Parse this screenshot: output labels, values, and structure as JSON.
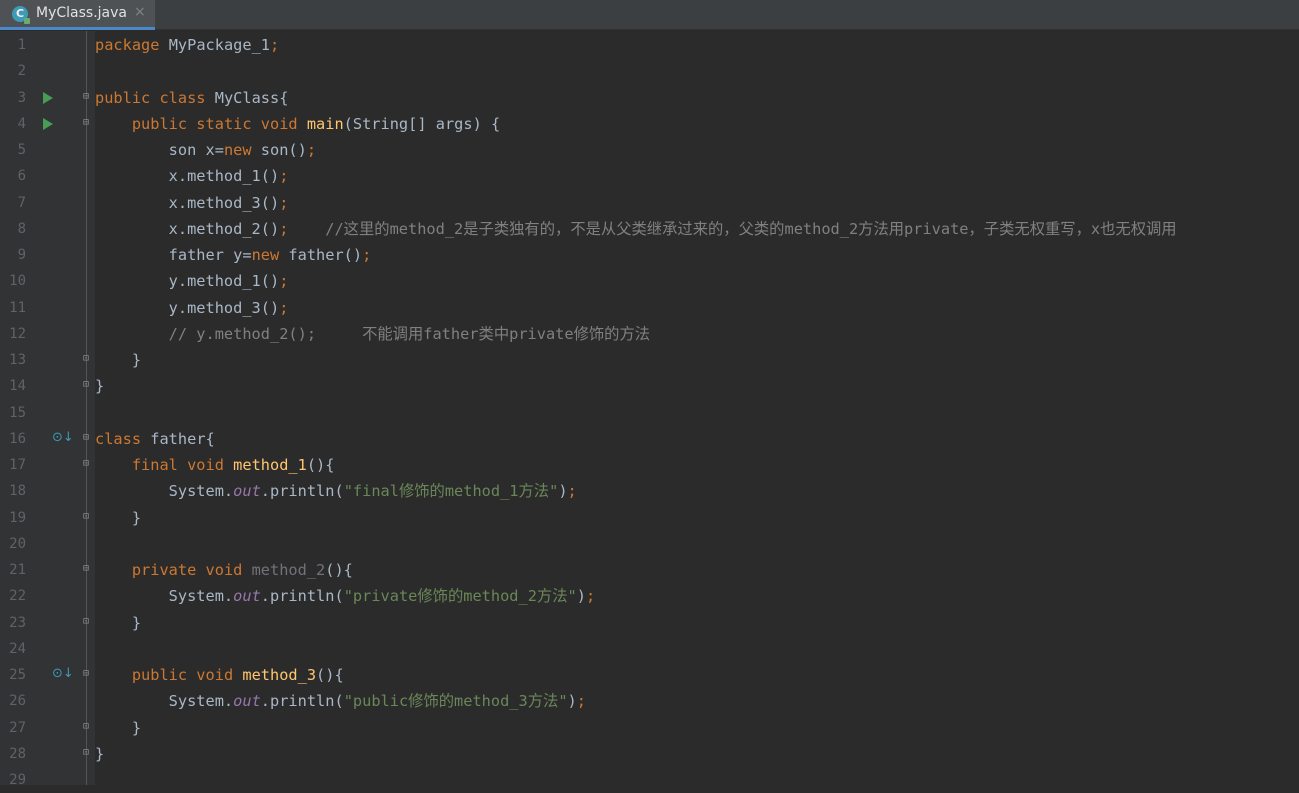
{
  "tab": {
    "label": "MyClass.java",
    "icon": "java-class-icon",
    "icon_letter": "C",
    "close": "×"
  },
  "lines": [
    {
      "n": "1",
      "tokens": [
        [
          "kw",
          "package "
        ],
        [
          "",
          "MyPackage_1"
        ],
        [
          "kw",
          ";"
        ]
      ]
    },
    {
      "n": "2",
      "tokens": []
    },
    {
      "n": "3",
      "tokens": [
        [
          "kw",
          "public class "
        ],
        [
          "",
          "MyClass{"
        ]
      ],
      "run": true,
      "fold": "open"
    },
    {
      "n": "4",
      "tokens": [
        [
          "",
          "    "
        ],
        [
          "kw",
          "public static void "
        ],
        [
          "fn",
          "main"
        ],
        [
          "",
          "(String[] args) {"
        ]
      ],
      "run": true,
      "fold": "open"
    },
    {
      "n": "5",
      "tokens": [
        [
          "",
          "        son x="
        ],
        [
          "kw",
          "new "
        ],
        [
          "",
          "son()"
        ],
        [
          "kw",
          ";"
        ]
      ]
    },
    {
      "n": "6",
      "tokens": [
        [
          "",
          "        x.method_1()"
        ],
        [
          "kw",
          ";"
        ]
      ]
    },
    {
      "n": "7",
      "tokens": [
        [
          "",
          "        x.method_3()"
        ],
        [
          "kw",
          ";"
        ]
      ]
    },
    {
      "n": "8",
      "tokens": [
        [
          "",
          "        x.method_2()"
        ],
        [
          "kw",
          ";"
        ],
        [
          "cm",
          "    //这里的method_2是子类独有的，不是从父类继承过来的，父类的method_2方法用private，子类无权重写，x也无权调用"
        ]
      ]
    },
    {
      "n": "9",
      "tokens": [
        [
          "",
          "        father y="
        ],
        [
          "kw",
          "new "
        ],
        [
          "",
          "father()"
        ],
        [
          "kw",
          ";"
        ]
      ]
    },
    {
      "n": "10",
      "tokens": [
        [
          "",
          "        y.method_1()"
        ],
        [
          "kw",
          ";"
        ]
      ]
    },
    {
      "n": "11",
      "tokens": [
        [
          "",
          "        y.method_3()"
        ],
        [
          "kw",
          ";"
        ]
      ]
    },
    {
      "n": "12",
      "tokens": [
        [
          "cm",
          "        // y.method_2();     不能调用father类中private修饰的方法"
        ]
      ]
    },
    {
      "n": "13",
      "tokens": [
        [
          "",
          "    }"
        ]
      ],
      "fold": "close"
    },
    {
      "n": "14",
      "tokens": [
        [
          "",
          "}"
        ]
      ],
      "fold": "close"
    },
    {
      "n": "15",
      "tokens": []
    },
    {
      "n": "16",
      "tokens": [
        [
          "kw",
          "class "
        ],
        [
          "",
          "father{"
        ]
      ],
      "override": true,
      "fold": "open"
    },
    {
      "n": "17",
      "tokens": [
        [
          "",
          "    "
        ],
        [
          "kw",
          "final void "
        ],
        [
          "fn",
          "method_1"
        ],
        [
          "",
          "(){"
        ]
      ],
      "fold": "open"
    },
    {
      "n": "18",
      "tokens": [
        [
          "",
          "        System."
        ],
        [
          "it",
          "out"
        ],
        [
          "",
          ".println("
        ],
        [
          "str",
          "\"final修饰的method_1方法\""
        ],
        [
          "",
          ")"
        ],
        [
          "kw",
          ";"
        ]
      ]
    },
    {
      "n": "19",
      "tokens": [
        [
          "",
          "    }"
        ]
      ],
      "fold": "close"
    },
    {
      "n": "20",
      "tokens": []
    },
    {
      "n": "21",
      "tokens": [
        [
          "",
          "    "
        ],
        [
          "kw",
          "private void "
        ],
        [
          "unused",
          "method_2"
        ],
        [
          "",
          "(){"
        ]
      ],
      "fold": "open"
    },
    {
      "n": "22",
      "tokens": [
        [
          "",
          "        System."
        ],
        [
          "it",
          "out"
        ],
        [
          "",
          ".println("
        ],
        [
          "str",
          "\"private修饰的method_2方法\""
        ],
        [
          "",
          ")"
        ],
        [
          "kw",
          ";"
        ]
      ]
    },
    {
      "n": "23",
      "tokens": [
        [
          "",
          "    }"
        ]
      ],
      "fold": "close"
    },
    {
      "n": "24",
      "tokens": []
    },
    {
      "n": "25",
      "tokens": [
        [
          "",
          "    "
        ],
        [
          "kw",
          "public void "
        ],
        [
          "fn",
          "method_3"
        ],
        [
          "",
          "(){"
        ]
      ],
      "override": true,
      "fold": "open"
    },
    {
      "n": "26",
      "tokens": [
        [
          "",
          "        System."
        ],
        [
          "it",
          "out"
        ],
        [
          "",
          ".println("
        ],
        [
          "str",
          "\"public修饰的method_3方法\""
        ],
        [
          "",
          ")"
        ],
        [
          "kw",
          ";"
        ]
      ]
    },
    {
      "n": "27",
      "tokens": [
        [
          "",
          "    }"
        ]
      ],
      "fold": "close"
    },
    {
      "n": "28",
      "tokens": [
        [
          "",
          "}"
        ]
      ],
      "fold": "close"
    },
    {
      "n": "29",
      "tokens": []
    }
  ],
  "gutter_icons": {
    "run": "run-icon",
    "override": "override-icon",
    "fold_open": "fold-open-icon",
    "fold_close": "fold-close-icon"
  },
  "colors": {
    "background": "#2b2b2b",
    "keyword": "#cc7832",
    "function": "#ffc66d",
    "string": "#6a8759",
    "comment": "#808080",
    "static_field": "#9876aa",
    "text": "#a9b7c6",
    "tab_underline": "#4a88c7"
  }
}
